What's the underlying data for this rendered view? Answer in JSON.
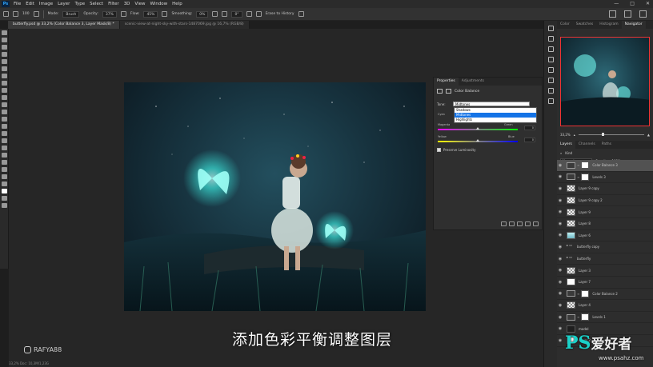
{
  "menu": {
    "logo": "Ps",
    "items": [
      "File",
      "Edit",
      "Image",
      "Layer",
      "Type",
      "Select",
      "Filter",
      "3D",
      "View",
      "Window",
      "Help"
    ]
  },
  "window_controls": [
    "—",
    "□",
    "✕"
  ],
  "options_bar": {
    "brush_size": "100",
    "mode_label": "Mode:",
    "mode_value": "Brush",
    "opacity_label": "Opacity:",
    "opacity_value": "37%",
    "flow_label": "Flow:",
    "flow_value": "45%",
    "smoothing_label": "Smoothing:",
    "smoothing_value": "0%",
    "angle_value": "0°",
    "erase_history": "Erase to History"
  },
  "doc_tabs": [
    {
      "label": "butterfly.psd @ 33,2% (Color Balance 3, Layer Mask/8) *",
      "active": true
    },
    {
      "label": "scenic-view-at-night-sky-with-stars-1487069.jpg @ 16,7% (RGB/8)",
      "active": false
    }
  ],
  "status_bar": "33,2%    Doc: 10,3M/1,23G",
  "properties": {
    "tabs": [
      "Properties",
      "Adjustments"
    ],
    "title": "Color Balance",
    "tone_label": "Tone:",
    "tone_value": "Midtones",
    "tone_options": [
      "Shadows",
      "Midtones",
      "Highlights"
    ],
    "color_label": "Cyan",
    "sliders": [
      {
        "left": "Magenta",
        "right": "Green",
        "value": "0"
      },
      {
        "left": "Yellow",
        "right": "Blue",
        "value": "0"
      }
    ],
    "preserve_label": "Preserve Luminosity"
  },
  "watermark": {
    "handle": "RAFYA88"
  },
  "subtitle": "添加色彩平衡调整图层",
  "right_panel": {
    "top_tabs": [
      "Color",
      "Swatches",
      "Histogram",
      "Navigator"
    ],
    "zoom": "33,2%",
    "layer_tabs": [
      "Layers",
      "Channels",
      "Paths"
    ],
    "kind_label": "Kind",
    "blend_mode": "Normal",
    "opacity_label": "Opacity:",
    "opacity_value": "100%",
    "lock_label": "Lock:",
    "fill_label": "Fill:",
    "fill_value": "100%",
    "layers": [
      {
        "name": "Color Balance 3",
        "type": "adj-mask",
        "active": true
      },
      {
        "name": "Levels 3",
        "type": "adj-mask"
      },
      {
        "name": "Layer 9 copy",
        "type": "check"
      },
      {
        "name": "Layer 9 copy 2",
        "type": "check"
      },
      {
        "name": "Layer 9",
        "type": "check"
      },
      {
        "name": "Layer 8",
        "type": "check"
      },
      {
        "name": "Layer 6",
        "type": "img"
      },
      {
        "name": "butterfly copy",
        "type": "folder"
      },
      {
        "name": "butterfly",
        "type": "folder"
      },
      {
        "name": "Layer 3",
        "type": "check"
      },
      {
        "name": "Layer 7",
        "type": "white"
      },
      {
        "name": "Color Balance 2",
        "type": "adj-mask"
      },
      {
        "name": "Layer 4",
        "type": "check"
      },
      {
        "name": "Levels 1",
        "type": "adj-mask"
      },
      {
        "name": "model",
        "type": "dark"
      },
      {
        "name": "Layer 2",
        "type": "white"
      }
    ]
  },
  "brand": {
    "ps": "PS",
    "cn": "爱好者",
    "url": "www.psahz.com"
  },
  "colors": {
    "accent": "#1473e6",
    "panel": "#2d2d2d",
    "glow": "#3ef2e6"
  }
}
